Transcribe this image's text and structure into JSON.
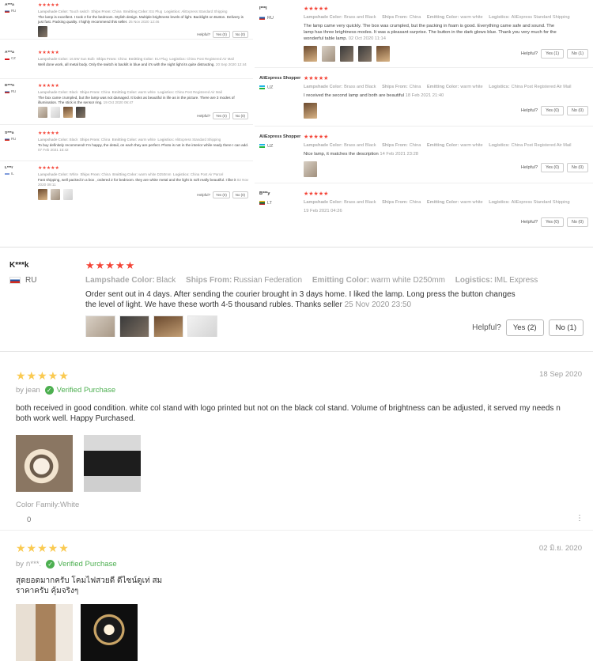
{
  "vote": {
    "helpful": "Helpful?"
  },
  "colors": {
    "star": "#f44336",
    "lz_star": "#faca51",
    "verified": "#4caf50"
  },
  "left_reviews": [
    {
      "user": "A***a",
      "country": "RU",
      "stars": "★★★★★",
      "attrs": [
        [
          "Lampshade Color:",
          "Touch switch"
        ],
        [
          "Ships From:",
          "China"
        ],
        [
          "Emitting Color:",
          "EU Plug"
        ],
        [
          "Logistics:",
          "AliExpress Standard Shipping"
        ]
      ],
      "text": "The lamp is excellent. I took 2 for the bedroom. Stylish design. Multiple brightness levels of light. Backlight on Button. Delivery is just fast. Packing quality. I highly recommend this seller.",
      "date": "25 Nov 2020 12:46",
      "yes": "Yes (0)",
      "no": "No (0)"
    },
    {
      "user": "A***a",
      "country": "CZ",
      "stars": "★★★★★",
      "attrs": [
        [
          "Lampshade Color:",
          "16.5W Sun Bulb"
        ],
        [
          "Ships From:",
          "China"
        ],
        [
          "Emitting Color:",
          "EU Plug"
        ],
        [
          "Logistics:",
          "China Post Registered Air Mail"
        ]
      ],
      "text": "Well done work, all metal body. Only the switch is backlit in blue and it's with the night light its quite distracting.",
      "date": "20 Sep 2020 12:44",
      "yes": "Yes (0)",
      "no": "No (0)"
    },
    {
      "user": "D***n",
      "country": "RU",
      "stars": "★★★★★",
      "attrs": [
        [
          "Lampshade Color:",
          "Black"
        ],
        [
          "Ships From:",
          "China"
        ],
        [
          "Emitting Color:",
          "warm white"
        ],
        [
          "Logistics:",
          "China Post Registered Air Mail"
        ]
      ],
      "text": "The box came crumpled, but the lamp was not damaged. It looks as beautiful in life as in the picture. There are 3 modes of illumination. The stick is the sensor ring.",
      "date": "19 Oct 2020 06:47",
      "yes": "Yes (0)",
      "no": "No (0)"
    },
    {
      "user": "S***a",
      "country": "RU",
      "stars": "★★★★★",
      "attrs": [
        [
          "Lampshade Color:",
          "Black"
        ],
        [
          "Ships From:",
          "China"
        ],
        [
          "Emitting Color:",
          "warm white"
        ],
        [
          "Logistics:",
          "AliExpress Standard Shipping"
        ]
      ],
      "text": "To buy definitely recommend! I'm happy, the detail, on each they are perfect. Photo is not in the interior while ready there I can add.",
      "date": "07 Feb 2021 15:42",
      "yes": "Yes (0)",
      "no": "No (0)"
    },
    {
      "user": "L***r",
      "country": "IL",
      "stars": "★★★★★",
      "attrs": [
        [
          "Lampshade Color:",
          "White"
        ],
        [
          "Ships From:",
          "China"
        ],
        [
          "Emitting Color:",
          "warm white D250mm"
        ],
        [
          "Logistics:",
          "China Post Air Parcel"
        ]
      ],
      "text": "Fast shipping, well packed in a box , ordered 2 for bedroom. they are white metal and the light is soft really beautiful. I like it",
      "date": "02 Nov 2020 09:11",
      "yes": "Yes (0)",
      "no": "No (0)"
    }
  ],
  "right_reviews": [
    {
      "user": "I***l",
      "country": "RU",
      "stars": "★★★★★",
      "attrs": [
        [
          "Lampshade Color:",
          "Brass and Black"
        ],
        [
          "Ships From:",
          "China"
        ],
        [
          "Emitting Color:",
          "warm white"
        ],
        [
          "Logistics:",
          "AliExpress Standard Shipping"
        ]
      ],
      "text": "The lamp came very quickly. The box was crumpled, but the packing in foam is good. Everything came safe and sound. The lamp has three brightness modes. It was a pleasant surprise. The button in the dark glows blue. Thank you very much for the wonderful table lamp.",
      "date": "02 Oct 2020 11:14",
      "yes": "Yes (1)",
      "no": "No (1)"
    },
    {
      "user": "AliExpress Shopper",
      "country": "UZ",
      "stars": "★★★★★",
      "attrs": [
        [
          "Lampshade Color:",
          "Brass and Black"
        ],
        [
          "Ships From:",
          "China"
        ],
        [
          "Emitting Color:",
          "warm white"
        ],
        [
          "Logistics:",
          "China Post Registered Air Mail"
        ]
      ],
      "text": "I received the second lamp and both are beautiful",
      "date": "18 Feb 2021 21:40",
      "yes": "Yes (0)",
      "no": "No (0)"
    },
    {
      "user": "AliExpress Shopper",
      "country": "UZ",
      "stars": "★★★★★",
      "attrs": [
        [
          "Lampshade Color:",
          "Brass and Black"
        ],
        [
          "Ships From:",
          "China"
        ],
        [
          "Emitting Color:",
          "warm white"
        ],
        [
          "Logistics:",
          "China Post Registered Air Mail"
        ]
      ],
      "text": "Nice lamp, it matches the description",
      "date": "14 Feb 2021 23:28",
      "yes": "Yes (0)",
      "no": "No (0)"
    },
    {
      "user": "B***y",
      "country": "LT",
      "stars": "★★★★★",
      "attrs": [
        [
          "Lampshade Color:",
          "Brass and Black"
        ],
        [
          "Ships From:",
          "China"
        ],
        [
          "Emitting Color:",
          "warm white"
        ],
        [
          "Logistics:",
          "AliExpress Standard Shipping"
        ]
      ],
      "text": "",
      "date": "19 Feb 2021 04:26",
      "yes": "Yes (0)",
      "no": "No (0)"
    }
  ],
  "mid_review": {
    "user": "K***k",
    "country": "RU",
    "stars": "★★★★★",
    "attrs": [
      [
        "Lampshade Color:",
        "Black"
      ],
      [
        "Ships From:",
        "Russian Federation"
      ],
      [
        "Emitting Color:",
        "warm white D250mm"
      ],
      [
        "Logistics:",
        "IML Express"
      ]
    ],
    "text": "Order sent out in 4 days. After sending the courier brought in 3 days home. I liked the lamp. Long press the button changes the level of light. We have these worth 4-5 thousand rubles. Thanks seller",
    "date": "25 Nov 2020 23:50",
    "helpful": "Helpful?",
    "yes": "Yes (2)",
    "no": "No (1)"
  },
  "lz_reviews": [
    {
      "stars": "★★★★★",
      "date": "18 Sep 2020",
      "by": "by jean",
      "verified": "Verified Purchase",
      "text": "both received in good condition.  white col stand with logo printed but not on the black col stand. Volume of brightness can be adjusted, it served my needs n both work well. Happy Purchased.",
      "meta": "Color Family:White",
      "likes": "0",
      "more": "⋮"
    },
    {
      "stars": "★★★★★",
      "date": "02 มิ.ย. 2020",
      "by": "by ก***.",
      "verified": "Verified Purchase",
      "text": "สุดยอดมากครับ โคมไฟสวยดี ดีไซน์ดูเท่ สมราคาครับ คุ้มจริงๆ"
    }
  ]
}
